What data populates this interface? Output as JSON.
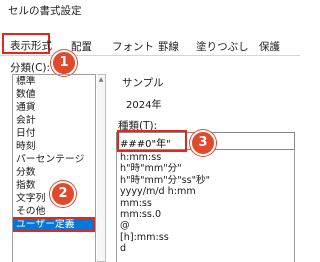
{
  "dialog": {
    "title": "セルの書式設定"
  },
  "tabs": [
    {
      "label": "表示形式"
    },
    {
      "label": "配置"
    },
    {
      "label": "フォント"
    },
    {
      "label": "罫線"
    },
    {
      "label": "塗りつぶし"
    },
    {
      "label": "保護"
    }
  ],
  "category": {
    "label": "分類(C):",
    "items": [
      "標準",
      "数値",
      "通貨",
      "会計",
      "日付",
      "時刻",
      "パーセンテージ",
      "分数",
      "指数",
      "文字列",
      "その他",
      "ユーザー定義"
    ],
    "selected": "ユーザー定義"
  },
  "sample": {
    "label": "サンプル",
    "value": "2024年"
  },
  "type_field": {
    "label": "種類(T):",
    "value": "###0\"年\"",
    "formats": [
      "h:mm:ss",
      "h\"時\"mm\"分\"",
      "h\"時\"mm\"分\"ss\"秒\"",
      "yyyy/m/d h:mm",
      "mm:ss",
      "mm:ss.0",
      "@",
      "[h]:mm:ss",
      "d"
    ]
  },
  "badges": [
    "1",
    "2",
    "3"
  ],
  "accent_color": "#e0281d",
  "selection_color": "#0078d7"
}
